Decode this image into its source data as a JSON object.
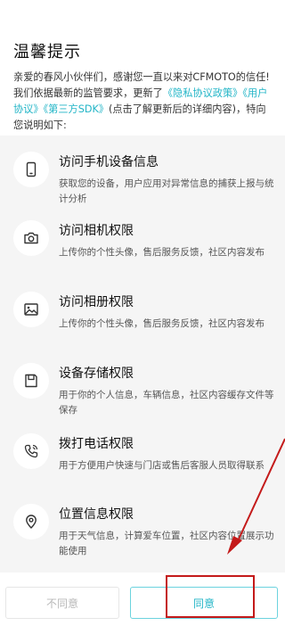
{
  "dialog": {
    "title": "温馨提示",
    "intro": {
      "part1": "亲爱的春风小伙伴们，感谢您一直以来对CFMOTO的信任! 我们依据最新的监管要求，更新了",
      "link1": "《隐私协议政策》",
      "link2": "《用户协议》",
      "link3": "《第三方SDK》",
      "part2": "(点击了解更新后的详细内容)，特向您说明如下:"
    }
  },
  "permissions": [
    {
      "icon": "phone-icon",
      "title": "访问手机设备信息",
      "desc": "获取您的设备，用户应用对异常信息的捕获上报与统计分析"
    },
    {
      "icon": "camera-icon",
      "title": "访问相机权限",
      "desc": "上传你的个性头像，售后服务反馈，社区内容发布"
    },
    {
      "icon": "image-icon",
      "title": "访问相册权限",
      "desc": "上传你的个性头像，售后服务反馈，社区内容发布"
    },
    {
      "icon": "storage-icon",
      "title": "设备存储权限",
      "desc": "用于你的个人信息，车辆信息，社区内容缓存文件等保存"
    },
    {
      "icon": "call-icon",
      "title": "拨打电话权限",
      "desc": "用于方便用户快速与门店或售后客服人员取得联系"
    },
    {
      "icon": "location-icon",
      "title": "位置信息权限",
      "desc": "用于天气信息，计算爱车位置，社区内容位置展示功能使用"
    }
  ],
  "footer": {
    "decline_label": "不同意",
    "agree_label": "同意"
  },
  "colors": {
    "link": "#22b5c7",
    "annotation": "#c41a1a",
    "panel_bg": "#f5f5f5"
  }
}
